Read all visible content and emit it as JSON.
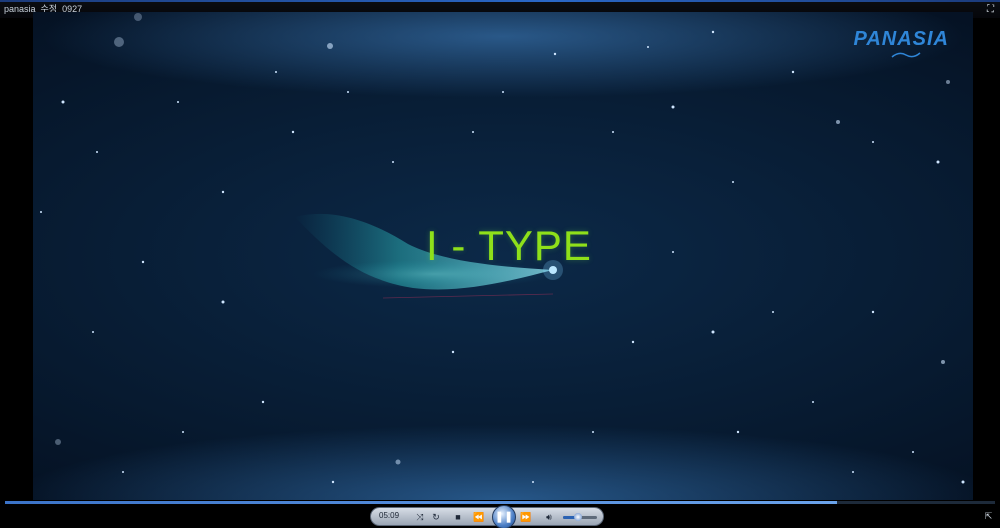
{
  "window": {
    "title": "panasia_수정_0927"
  },
  "video": {
    "brand_logo": "PANASIA",
    "title_overlay": "I - TYPE"
  },
  "playback": {
    "elapsed_time": "05:09",
    "progress": 0.84,
    "volume": 0.45,
    "state": "playing"
  },
  "icons": {
    "fullscreen": "fullscreen-icon",
    "shuffle": "shuffle-icon",
    "repeat": "repeat-icon",
    "stop": "stop-icon",
    "previous": "previous-icon",
    "play_pause": "pause-icon",
    "next": "next-icon",
    "mute": "speaker-icon",
    "miniplayer": "switch-to-library-icon"
  },
  "colors": {
    "title_overlay": "#8fe01a",
    "logo": "#2f86d8",
    "seek_fill": "#3b73c8"
  }
}
